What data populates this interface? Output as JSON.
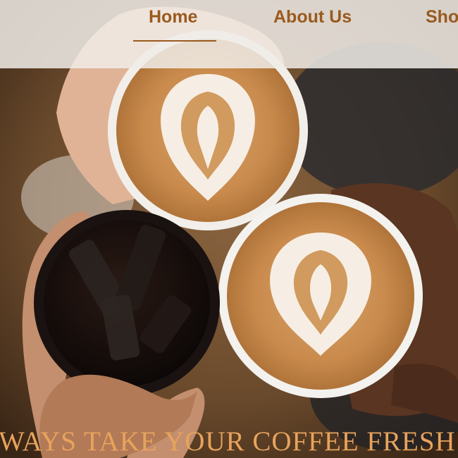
{
  "nav": {
    "items": [
      {
        "label": "Home",
        "active": true
      },
      {
        "label": "About Us",
        "active": false
      },
      {
        "label": "Sho",
        "active": false
      }
    ],
    "accent_color": "#9a5a1e"
  },
  "hero": {
    "tagline": "WAYS TAKE YOUR COFFEE FRESH",
    "tagline_color": "#e8a35c",
    "image_subject": "four-hands-toasting-coffee-cups"
  }
}
